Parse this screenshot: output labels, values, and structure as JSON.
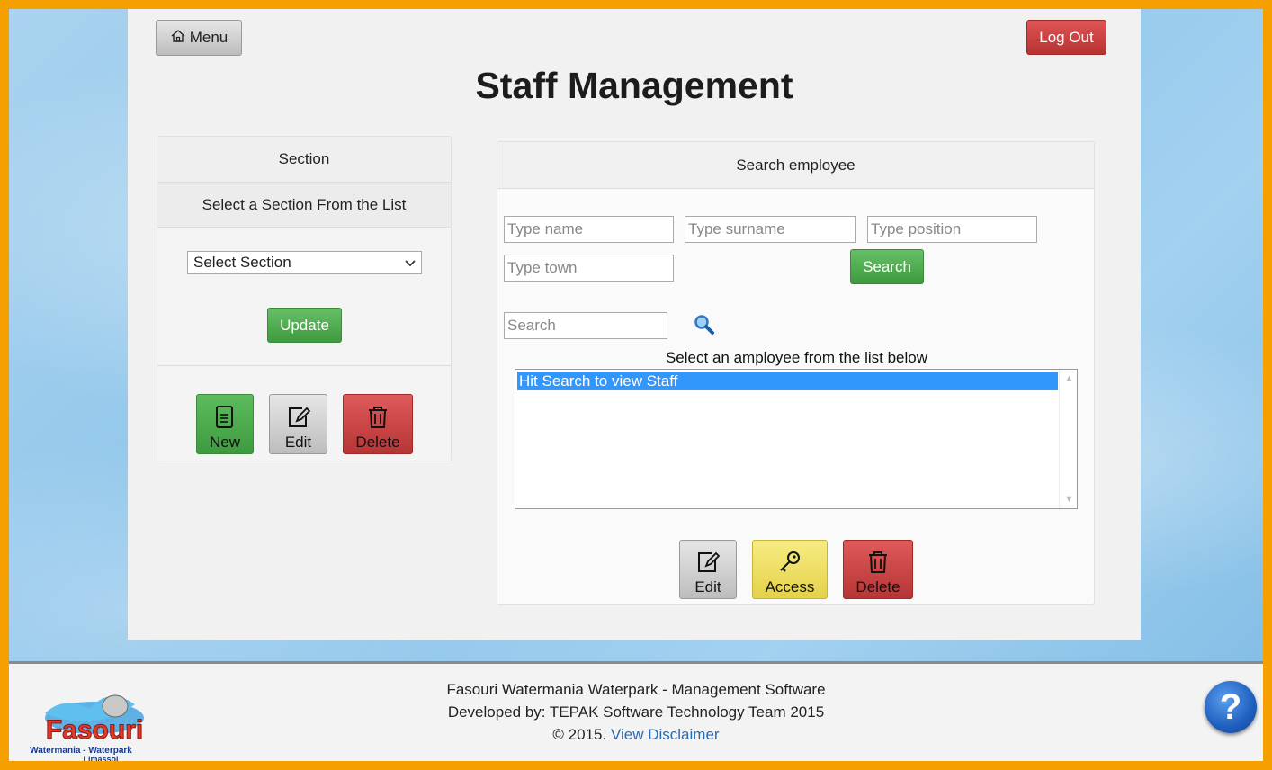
{
  "header": {
    "menu_label": "Menu",
    "logout_label": "Log Out",
    "title": "Staff Management"
  },
  "section_panel": {
    "heading": "Section",
    "subheading": "Select a Section From the List",
    "select_value": "Select Section",
    "update_label": "Update",
    "actions": {
      "new_label": "New",
      "edit_label": "Edit",
      "delete_label": "Delete"
    }
  },
  "search_panel": {
    "heading": "Search employee",
    "name_placeholder": "Type name",
    "surname_placeholder": "Type surname",
    "position_placeholder": "Type position",
    "town_placeholder": "Type town",
    "search_button": "Search",
    "filter_placeholder": "Search",
    "list_caption": "Select an amployee from the list below",
    "list_items": [
      "Hit Search to view Staff"
    ],
    "actions": {
      "edit_label": "Edit",
      "access_label": "Access",
      "delete_label": "Delete"
    }
  },
  "footer": {
    "line1": "Fasouri Watermania Waterpark - Management Software",
    "line2": "Developed by: TEPAK Software Technology Team 2015",
    "copyright": "© 2015.",
    "disclaimer_link": "View Disclaimer",
    "logo_text": "Fasouri",
    "logo_sub": "Watermania - Waterpark",
    "logo_city": "Limassol",
    "help_label": "?"
  },
  "colors": {
    "border_orange": "#f5a000",
    "green": "#4caf50",
    "red": "#c94040",
    "yellow": "#ece060",
    "selection_blue": "#3297fd"
  }
}
